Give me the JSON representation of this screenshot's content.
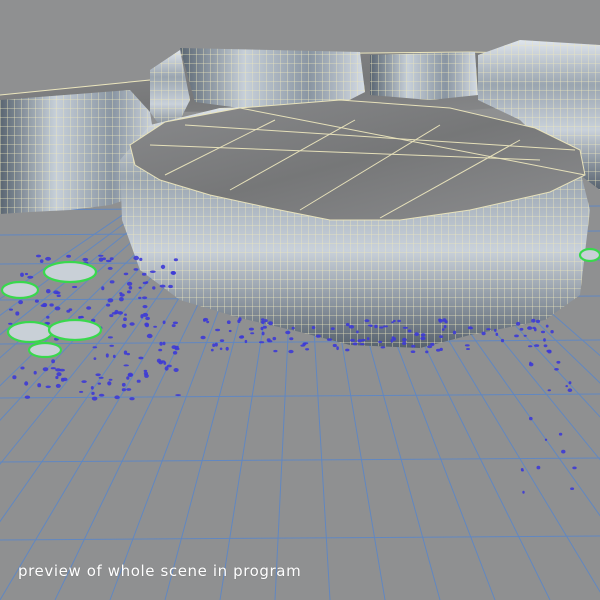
{
  "viewport": {
    "caption": "preview of whole scene in program"
  },
  "colors": {
    "background": "#8f9091",
    "ground_grid": "#5f87c4",
    "wireframe": "#e9e2b3",
    "rock_dark": "#4f5964",
    "rock_light": "#dbe2ea",
    "stone_top": "#7f8081",
    "debris_blue": "#3d3ad6",
    "debris_green": "#39d84d"
  },
  "icons": {
    "scene_geometry": "3d-rock-platform-wireframe"
  }
}
